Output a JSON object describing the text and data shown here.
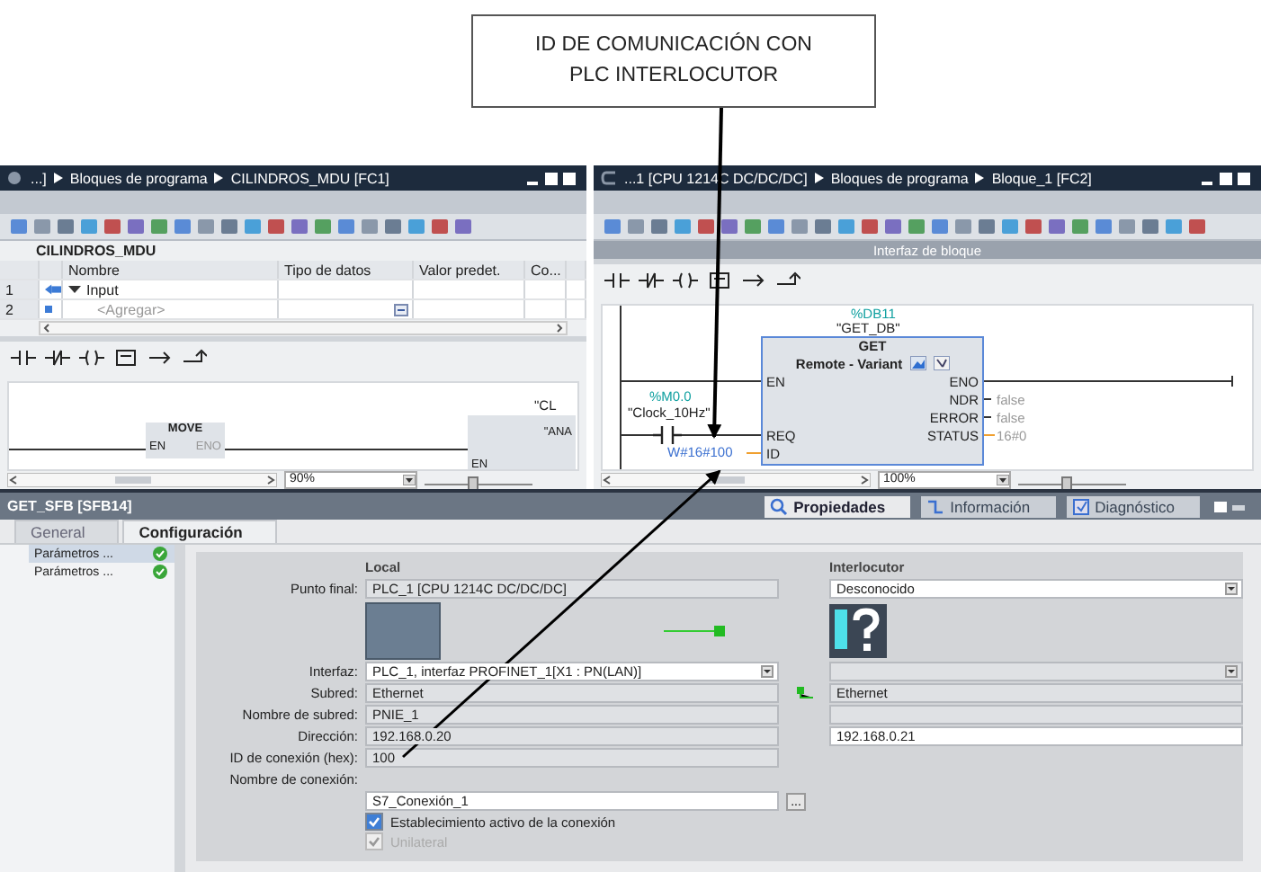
{
  "annotation": {
    "text": "ID DE COMUNICACIÓN CON PLC INTERLOCUTOR"
  },
  "left_editor": {
    "breadcrumb": [
      "...]",
      "Bloques de programa",
      "CILINDROS_MDU [FC1]"
    ],
    "block_name": "CILINDROS_MDU",
    "columns": [
      "Nombre",
      "Tipo de datos",
      "Valor predet.",
      "Co..."
    ],
    "rows": [
      {
        "number": "1",
        "name": "Input",
        "kind": "section",
        "expanded": true
      },
      {
        "number": "2",
        "name": "<Agregar>",
        "kind": "add"
      }
    ],
    "tags": [
      "\"CL",
      "\"ANA"
    ],
    "move_box": {
      "title": "MOVE",
      "input": "EN",
      "output": "ENO"
    },
    "second_box": {
      "input": "EN"
    },
    "zoom_slider": {
      "level": 0.45
    },
    "zoom": "90%"
  },
  "right_editor": {
    "breadcrumb": [
      "...1 [CPU 1214C DC/DC/DC]",
      "Bloques de programa",
      "Bloque_1 [FC2]"
    ],
    "interface_bar": "Interfaz de bloque",
    "instance": {
      "address": "%DB11",
      "name": "\"GET_DB\""
    },
    "block": {
      "title": "GET",
      "subtitle": "Remote - Variant",
      "rows": [
        {
          "input": "EN",
          "output": "ENO"
        },
        {
          "output": "NDR",
          "value": "false"
        },
        {
          "output": "ERROR",
          "value": "false"
        },
        {
          "input": "REQ",
          "output": "STATUS",
          "value": "16#0"
        },
        {
          "input": "ID"
        }
      ]
    },
    "zoom_slider": {
      "level": 0.45
    },
    "contact": {
      "address": "%M0.0",
      "name": "\"Clock_10Hz\""
    },
    "id_value": "W#16#100",
    "zoom": "100%"
  },
  "properties": {
    "title": "GET_SFB [SFB14]",
    "view_tabs": [
      {
        "label": "Propiedades",
        "selected": true
      },
      {
        "label": "Información",
        "selected": false
      },
      {
        "label": "Diagnóstico",
        "selected": false
      }
    ],
    "tabs": [
      {
        "label": "General",
        "selected": false
      },
      {
        "label": "Configuración",
        "selected": true
      }
    ],
    "nav": [
      {
        "label": "Parámetros ...",
        "selected": true,
        "valid": true
      },
      {
        "label": "Parámetros ...",
        "selected": false,
        "valid": true
      }
    ],
    "local_header": "Local",
    "partner_header": "Interlocutor",
    "rows": [
      {
        "kind": "fields",
        "label": "Punto final:",
        "local": {
          "value": "PLC_1 [CPU 1214C DC/DC/DC]",
          "editable": false,
          "dropdown": false
        },
        "partner": {
          "value": "Desconocido",
          "editable": true,
          "dropdown": true
        }
      },
      {
        "kind": "images"
      },
      {
        "kind": "fields",
        "label": "Interfaz:",
        "local": {
          "value": "PLC_1, interfaz PROFINET_1[X1 : PN(LAN)]",
          "editable": true,
          "dropdown": true
        },
        "partner": {
          "editable": false,
          "dropdown": true
        }
      },
      {
        "kind": "fields",
        "label": "Subred:",
        "connected": true,
        "local": {
          "value": "Ethernet",
          "editable": false,
          "dropdown": false
        },
        "partner": {
          "value": "Ethernet",
          "editable": false,
          "dropdown": false
        }
      },
      {
        "kind": "fields",
        "label": "Nombre de subred:",
        "local": {
          "value": "PNIE_1",
          "editable": false,
          "dropdown": false
        },
        "partner": {
          "editable": false,
          "dropdown": false
        }
      },
      {
        "kind": "fields",
        "label": "Dirección:",
        "local": {
          "value": "192.168.0.20",
          "editable": false,
          "dropdown": false
        },
        "partner": {
          "value": "192.168.0.21",
          "editable": true,
          "dropdown": false
        }
      },
      {
        "kind": "fields",
        "label": "ID de conexión (hex):",
        "local": {
          "value": "100",
          "editable": false,
          "dropdown": false
        }
      }
    ],
    "connection_name": {
      "label": "Nombre de conexión:",
      "value": "S7_Conexión_1",
      "button": "..."
    },
    "checkboxes": [
      {
        "label": "Establecimiento activo de la conexión",
        "checked": true,
        "disabled": false
      },
      {
        "label": "Unilateral",
        "checked": true,
        "disabled": true
      }
    ]
  }
}
